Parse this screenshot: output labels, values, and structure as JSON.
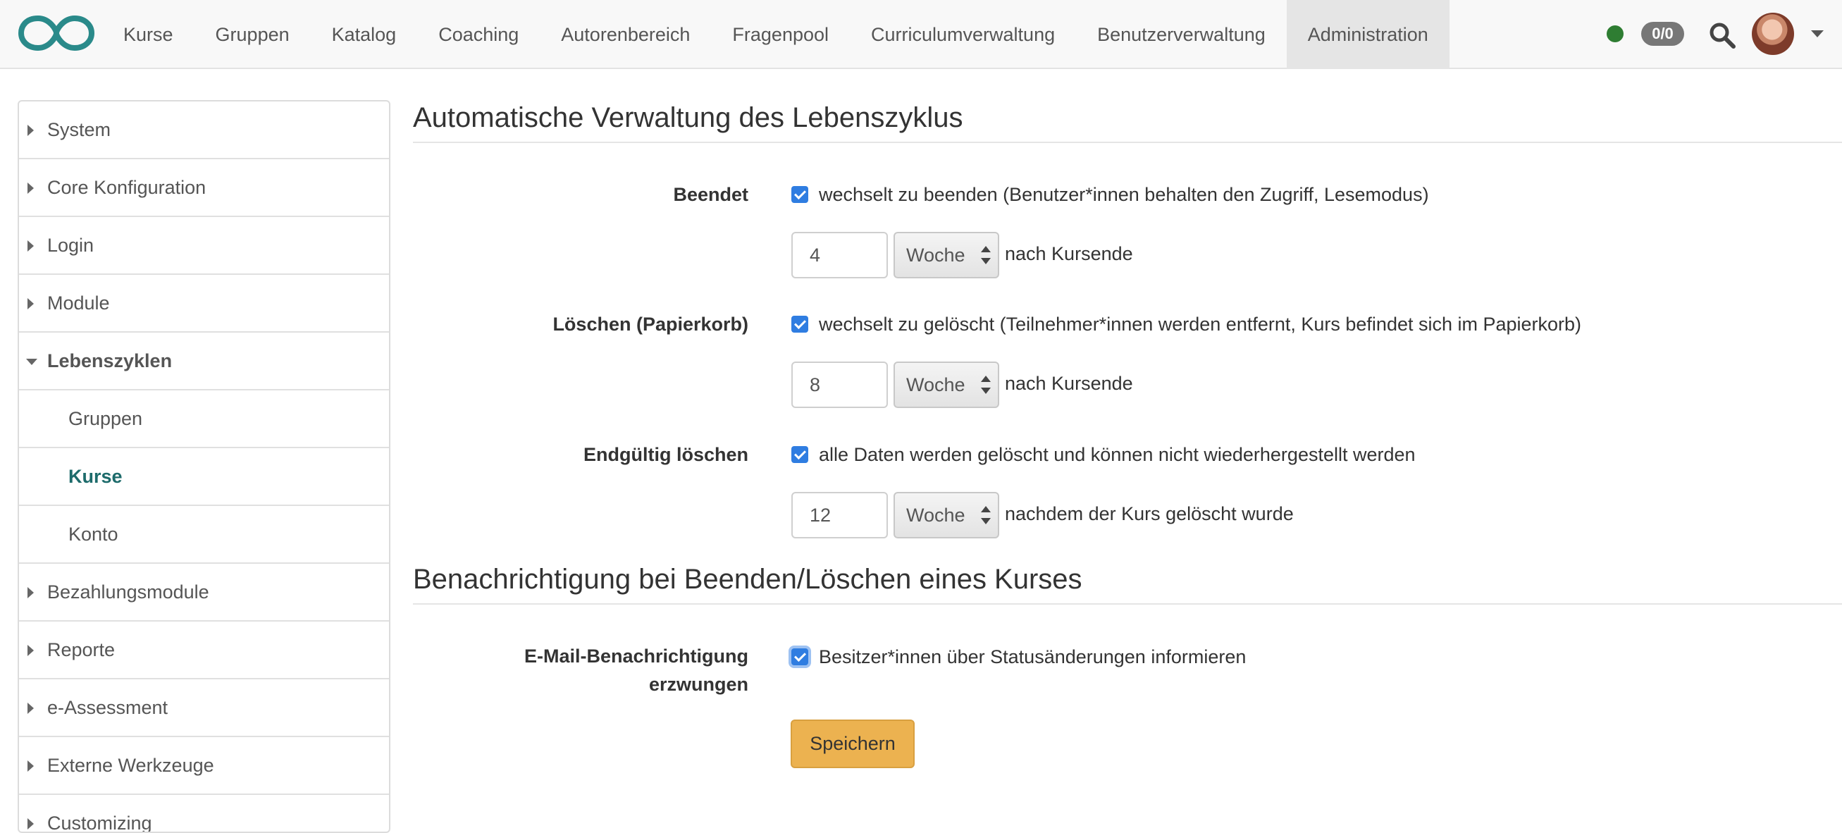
{
  "nav": {
    "items": [
      "Kurse",
      "Gruppen",
      "Katalog",
      "Coaching",
      "Autorenbereich",
      "Fragenpool",
      "Curriculumverwaltung",
      "Benutzerverwaltung",
      "Administration"
    ],
    "active": "Administration",
    "badge": "0/0",
    "logo_color": "#2a8a8a",
    "status_color": "#2e7d32",
    "icons": [
      "infinity-logo",
      "online-status-dot",
      "search-icon",
      "user-avatar",
      "chevron-down-icon"
    ]
  },
  "sidebar": {
    "items": [
      {
        "label": "System"
      },
      {
        "label": "Core Konfiguration"
      },
      {
        "label": "Login"
      },
      {
        "label": "Module"
      },
      {
        "label": "Lebenszyklen"
      },
      {
        "label": "Gruppen"
      },
      {
        "label": "Kurse"
      },
      {
        "label": "Konto"
      },
      {
        "label": "Bezahlungsmodule"
      },
      {
        "label": "Reporte"
      },
      {
        "label": "e-Assessment"
      },
      {
        "label": "Externe Werkzeuge"
      },
      {
        "label": "Customizing"
      }
    ]
  },
  "lifecycle": {
    "title": "Automatische Verwaltung des Lebenszyklus",
    "rows": [
      {
        "label": "Beendet",
        "checkbox_text": "wechselt zu beenden (Benutzer*innen behalten den Zugriff, Lesemodus)",
        "value": "4",
        "unit": "Woche",
        "after": "nach Kursende"
      },
      {
        "label": "Löschen (Papierkorb)",
        "checkbox_text": "wechselt zu gelöscht (Teilnehmer*innen werden entfernt, Kurs befindet sich im Papierkorb)",
        "value": "8",
        "unit": "Woche",
        "after": "nach Kursende"
      },
      {
        "label": "Endgültig löschen",
        "checkbox_text": "alle Daten werden gelöscht und können nicht wiederhergestellt werden",
        "value": "12",
        "unit": "Woche",
        "after": "nachdem der Kurs gelöscht wurde"
      }
    ]
  },
  "notification": {
    "title": "Benachrichtigung bei Beenden/Löschen eines Kurses",
    "label_line1": "E-Mail-Benachrichtigung",
    "label_line2": "erzwungen",
    "checkbox_text": "Besitzer*innen über Statusänderungen informieren"
  },
  "save_label": "Speichern",
  "colors": {
    "checkbox": "#2f7de1",
    "save_button": "#ecb250",
    "selected_sidebar": "#1d6b6b"
  }
}
